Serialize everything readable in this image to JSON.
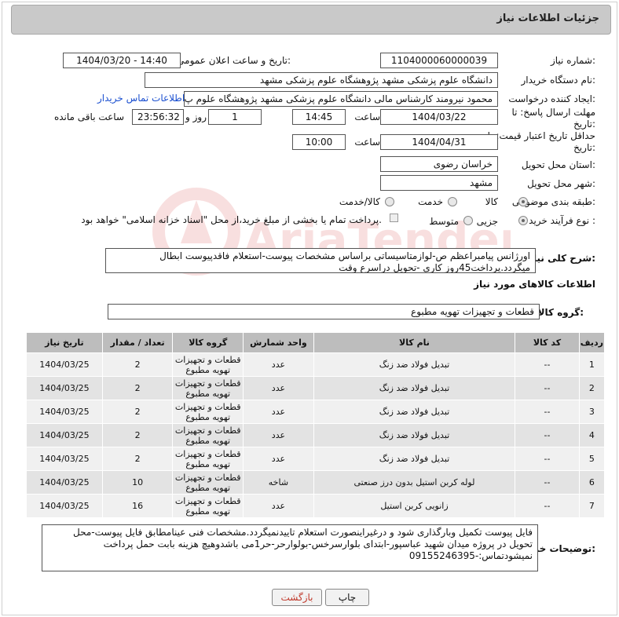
{
  "header": {
    "title": "جزئیات اطلاعات نیاز"
  },
  "form": {
    "need_number_label": "شماره نیاز:",
    "need_number": "1104000060000039",
    "announce_label": "تاریخ و ساعت اعلان عمومی:",
    "announce_value": "1404/03/20 - 14:40",
    "buyer_org_label": "نام دستگاه خریدار:",
    "buyer_org": "دانشگاه علوم پزشکی مشهد   پژوهشگاه علوم پزشکی مشهد",
    "creator_label": "ایجاد کننده درخواست:",
    "creator": "محمود نیرومند کارشناس مالی دانشگاه علوم پزشکی مشهد   پژوهشگاه علوم پ",
    "contact_link": "اطلاعات تماس خریدار",
    "deadline_label": "مهلت ارسال پاسخ: تا تاریخ:",
    "deadline_date": "1404/03/22",
    "time_label": "ساعت",
    "deadline_time": "14:45",
    "days_value": "1",
    "days_label": "روز و",
    "remaining_time": "23:56:32",
    "remaining_label": "ساعت باقی مانده",
    "price_valid_label": "حداقل تاریخ اعتبار قیمت: تا تاریخ:",
    "price_valid_date": "1404/04/31",
    "price_valid_time": "10:00",
    "province_label": "استان محل تحویل:",
    "province": "خراسان رضوی",
    "city_label": "شهر محل تحویل:",
    "city": "مشهد",
    "category_label": "طبقه بندی موضوعی:",
    "category_options": [
      "کالا",
      "خدمت",
      "کالا/خدمت"
    ],
    "process_label": "نوع فرآیند خرید :",
    "process_options": [
      "جزیی",
      "متوسط"
    ],
    "payment_note": "پرداخت تمام یا بخشی از مبلغ خرید،از محل \"اسناد خزانه اسلامی\" خواهد بود."
  },
  "summary": {
    "label": "شرح کلی نیاز:",
    "text": "اورژانس پیامبراعظم ص-لوازمتاسیساتی براساس مشخصات پیوست-استعلام فاقدپیوست ابطال میگردد.پرداخت45روز کاری -تحویل دراسرع وقت"
  },
  "goods": {
    "section_title": "اطلاعات کالاهای مورد نیاز",
    "group_label": "گروه کالا:",
    "group_value": "قطعات و تجهیزات تهویه مطبوع",
    "columns": [
      "ردیف",
      "کد کالا",
      "نام کالا",
      "واحد شمارش",
      "گروه کالا",
      "تعداد / مقدار",
      "تاریخ نیاز"
    ],
    "rows": [
      {
        "row": "1",
        "code": "--",
        "name": "تبدیل فولاد ضد زنگ",
        "unit": "عدد",
        "group": "قطعات و تجهیزات تهویه مطبوع",
        "qty": "2",
        "date": "1404/03/25"
      },
      {
        "row": "2",
        "code": "--",
        "name": "تبدیل فولاد ضد زنگ",
        "unit": "عدد",
        "group": "قطعات و تجهیزات تهویه مطبوع",
        "qty": "2",
        "date": "1404/03/25"
      },
      {
        "row": "3",
        "code": "--",
        "name": "تبدیل فولاد ضد زنگ",
        "unit": "عدد",
        "group": "قطعات و تجهیزات تهویه مطبوع",
        "qty": "2",
        "date": "1404/03/25"
      },
      {
        "row": "4",
        "code": "--",
        "name": "تبدیل فولاد ضد زنگ",
        "unit": "عدد",
        "group": "قطعات و تجهیزات تهویه مطبوع",
        "qty": "2",
        "date": "1404/03/25"
      },
      {
        "row": "5",
        "code": "--",
        "name": "تبدیل فولاد ضد زنگ",
        "unit": "عدد",
        "group": "قطعات و تجهیزات تهویه مطبوع",
        "qty": "2",
        "date": "1404/03/25"
      },
      {
        "row": "6",
        "code": "--",
        "name": "لوله کربن استیل بدون درز صنعتی",
        "unit": "شاخه",
        "group": "قطعات و تجهیزات تهویه مطبوع",
        "qty": "10",
        "date": "1404/03/25"
      },
      {
        "row": "7",
        "code": "--",
        "name": "زانویی کربن استیل",
        "unit": "عدد",
        "group": "قطعات و تجهیزات تهویه مطبوع",
        "qty": "16",
        "date": "1404/03/25"
      }
    ]
  },
  "buyer_notes": {
    "label": "توضیحات خریدار:",
    "text": "فایل پیوست تکمیل وبارگذاری شود و درغیراینصورت استعلام تاییدنمیگردد.مشخصات فنی عینامطابق فایل پیوست-محل تحویل در پروژه میدان شهید عباسپور-ابتدای بلوارسرخس-بولوارحر-حر1می باشدوهیچ هزینه بابت حمل پرداخت نمیشودتماس:-09155246395"
  },
  "buttons": {
    "print": "چاپ",
    "back": "بازگشت"
  },
  "watermark_text": "AriaTender.neT",
  "colors": {
    "link": "#1a4fd0",
    "header_bg": "#c9c9c9",
    "table_header": "#bdbdbd",
    "back_button_text": "#c0392b"
  }
}
